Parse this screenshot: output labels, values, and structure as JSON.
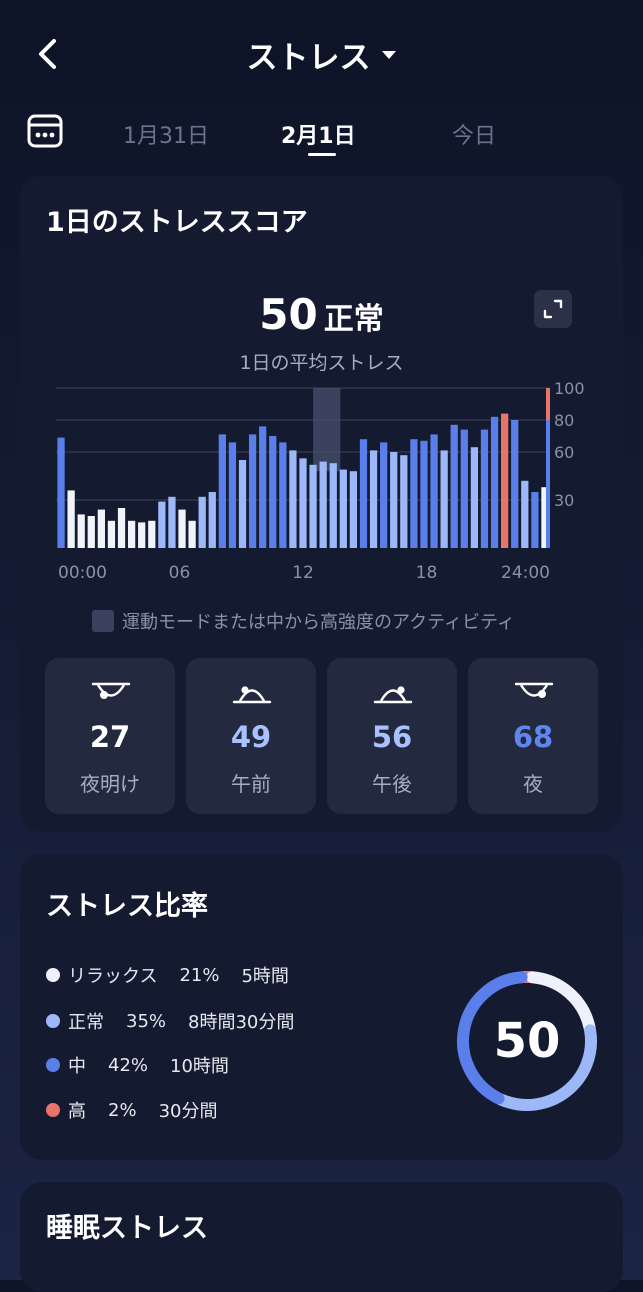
{
  "header": {
    "title": "ストレス",
    "dates": {
      "prev": "1月31日",
      "current": "2月1日",
      "next": "今日"
    }
  },
  "daily": {
    "title": "1日のストレススコア",
    "score": "50",
    "score_label": "正常",
    "avg_label": "1日の平均ストレス",
    "legend": "運動モードまたは中から高強度のアクティビティ"
  },
  "periods": [
    {
      "label": "夜明け",
      "value": "27",
      "color": "#ffffff"
    },
    {
      "label": "午前",
      "value": "49",
      "color": "#a8c1ff"
    },
    {
      "label": "午後",
      "value": "56",
      "color": "#a8c1ff"
    },
    {
      "label": "夜",
      "value": "68",
      "color": "#5f86ef"
    }
  ],
  "ratio": {
    "title": "ストレス比率",
    "items": [
      {
        "name": "リラックス",
        "percent": "21%",
        "duration": "5時間",
        "color": "#eef1fb"
      },
      {
        "name": "正常",
        "percent": "35%",
        "duration": "8時間30分間",
        "color": "#9db8f8"
      },
      {
        "name": "中",
        "percent": "42%",
        "duration": "10時間",
        "color": "#5a7fea"
      },
      {
        "name": "高",
        "percent": "2%",
        "duration": "30分間",
        "color": "#e9746a"
      }
    ],
    "center_value": "50"
  },
  "sleep": {
    "title": "睡眠ストレス"
  },
  "chart_data": {
    "type": "bar",
    "title": "",
    "xlabel": "",
    "ylabel": "",
    "x_ticks": [
      "00:00",
      "06",
      "12",
      "18",
      "24:00"
    ],
    "y_ticks": [
      100,
      80,
      60,
      30
    ],
    "ylim": [
      0,
      100
    ],
    "highlight_window": "exercise-mode-period",
    "values": [
      69,
      36,
      21,
      20,
      24,
      17,
      25,
      17,
      16,
      17,
      29,
      32,
      24,
      17,
      32,
      35,
      71,
      66,
      55,
      71,
      76,
      70,
      66,
      61,
      56,
      52,
      54,
      53,
      49,
      48,
      68,
      61,
      66,
      60,
      58,
      68,
      67,
      71,
      61,
      77,
      74,
      63,
      74,
      82,
      84
    ],
    "colors": [
      "#5a7fea",
      "#f1f3fb",
      "#f1f3fb",
      "#f1f3fb",
      "#f1f3fb",
      "#f1f3fb",
      "#f1f3fb",
      "#f1f3fb",
      "#f1f3fb",
      "#f1f3fb",
      "#9db8f8",
      "#9db8f8",
      "#f1f3fb",
      "#f1f3fb",
      "#9db8f8",
      "#9db8f8",
      "#5a7fea",
      "#5a7fea",
      "#9db8f8",
      "#5a7fea",
      "#5a7fea",
      "#5a7fea",
      "#5a7fea",
      "#9db8f8",
      "#9db8f8",
      "#9db8f8",
      "#9db8f8",
      "#9db8f8",
      "#9db8f8",
      "#9db8f8",
      "#5a7fea",
      "#9db8f8",
      "#5a7fea",
      "#9db8f8",
      "#9db8f8",
      "#5a7fea",
      "#5a7fea",
      "#5a7fea",
      "#9db8f8",
      "#5a7fea",
      "#5a7fea",
      "#9db8f8",
      "#5a7fea",
      "#5a7fea",
      "#e9746a",
      "#5a7fea",
      "#5a7fea",
      "#5a7fea",
      "#9db8f8"
    ],
    "tail_values": [
      80,
      42,
      35,
      38
    ],
    "tail_colors": [
      "#5a7fea",
      "#9db8f8",
      "#5a7fea",
      "#f1f3fb"
    ]
  }
}
